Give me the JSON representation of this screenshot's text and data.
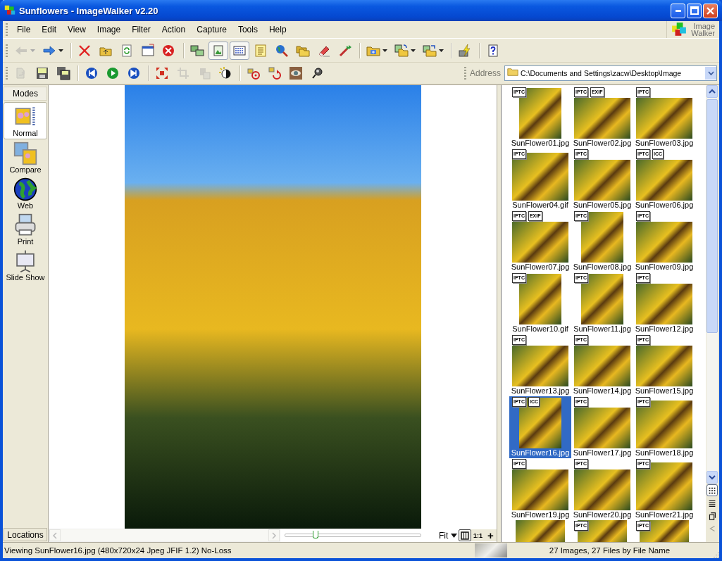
{
  "window": {
    "title": "Sunflowers - ImageWalker v2.20"
  },
  "menu": [
    "File",
    "Edit",
    "View",
    "Image",
    "Filter",
    "Action",
    "Capture",
    "Tools",
    "Help"
  ],
  "logo": {
    "text": "Image Walker"
  },
  "toolbar_main": [
    {
      "kind": "button",
      "disabled": true,
      "pressed": false,
      "dropdown": true
    },
    {
      "kind": "button",
      "disabled": false,
      "pressed": false,
      "dropdown": true
    },
    {
      "kind": "separator"
    },
    {
      "kind": "button",
      "disabled": false,
      "pressed": false,
      "dropdown": false
    },
    {
      "kind": "button",
      "disabled": false,
      "pressed": false,
      "dropdown": false
    },
    {
      "kind": "button",
      "disabled": false,
      "pressed": false,
      "dropdown": false
    },
    {
      "kind": "button",
      "disabled": false,
      "pressed": false,
      "dropdown": false
    },
    {
      "kind": "button",
      "disabled": false,
      "pressed": false,
      "dropdown": false
    },
    {
      "kind": "separator"
    },
    {
      "kind": "button",
      "disabled": false,
      "pressed": false,
      "dropdown": false
    },
    {
      "kind": "button",
      "disabled": false,
      "pressed": true,
      "dropdown": false
    },
    {
      "kind": "button",
      "disabled": false,
      "pressed": true,
      "dropdown": false
    },
    {
      "kind": "button",
      "disabled": false,
      "pressed": false,
      "dropdown": false
    },
    {
      "kind": "button",
      "disabled": false,
      "pressed": false,
      "dropdown": false
    },
    {
      "kind": "button",
      "disabled": false,
      "pressed": false,
      "dropdown": false
    },
    {
      "kind": "button",
      "disabled": false,
      "pressed": false,
      "dropdown": false
    },
    {
      "kind": "button",
      "disabled": false,
      "pressed": false,
      "dropdown": false
    },
    {
      "kind": "separator"
    },
    {
      "kind": "button",
      "disabled": false,
      "pressed": false,
      "dropdown": true
    },
    {
      "kind": "button",
      "disabled": false,
      "pressed": false,
      "dropdown": true
    },
    {
      "kind": "button",
      "disabled": false,
      "pressed": false,
      "dropdown": true
    },
    {
      "kind": "separator"
    },
    {
      "kind": "button",
      "disabled": false,
      "pressed": false,
      "dropdown": false
    },
    {
      "kind": "separator"
    },
    {
      "kind": "button",
      "disabled": false,
      "pressed": false,
      "dropdown": false
    }
  ],
  "toolbar_edit": [
    {
      "kind": "button",
      "disabled": true,
      "pressed": false,
      "dropdown": false
    },
    {
      "kind": "button",
      "disabled": false,
      "pressed": false,
      "dropdown": false
    },
    {
      "kind": "button",
      "disabled": false,
      "pressed": false,
      "dropdown": false
    },
    {
      "kind": "separator"
    },
    {
      "kind": "button",
      "disabled": false,
      "pressed": false,
      "dropdown": false
    },
    {
      "kind": "button",
      "disabled": false,
      "pressed": false,
      "dropdown": false
    },
    {
      "kind": "button",
      "disabled": false,
      "pressed": false,
      "dropdown": false
    },
    {
      "kind": "separator"
    },
    {
      "kind": "button",
      "disabled": false,
      "pressed": false,
      "dropdown": false
    },
    {
      "kind": "button",
      "disabled": true,
      "pressed": false,
      "dropdown": false
    },
    {
      "kind": "button",
      "disabled": true,
      "pressed": false,
      "dropdown": false
    },
    {
      "kind": "button",
      "disabled": false,
      "pressed": false,
      "dropdown": false
    },
    {
      "kind": "separator"
    },
    {
      "kind": "button",
      "disabled": false,
      "pressed": false,
      "dropdown": false
    },
    {
      "kind": "button",
      "disabled": false,
      "pressed": false,
      "dropdown": false
    },
    {
      "kind": "button",
      "disabled": false,
      "pressed": false,
      "dropdown": false
    },
    {
      "kind": "button",
      "disabled": false,
      "pressed": false,
      "dropdown": false
    }
  ],
  "address": {
    "label": "Address",
    "value": "C:\\Documents and Settings\\zacw\\Desktop\\Image"
  },
  "modes": {
    "title": "Modes",
    "items": [
      {
        "label": "Normal",
        "selected": true
      },
      {
        "label": "Compare",
        "selected": false
      },
      {
        "label": "Web",
        "selected": false
      },
      {
        "label": "Print",
        "selected": false
      },
      {
        "label": "Slide Show",
        "selected": false
      }
    ],
    "footer": "Locations"
  },
  "viewer": {
    "zoom": {
      "level": 0.22,
      "mode": "Fit"
    },
    "fit_button": {
      "pressed": true
    },
    "actual_size": "1:1",
    "zoom_in": "+"
  },
  "thumbnails": [
    {
      "name": "SunFlower01.jpg",
      "badges": [
        "IPTC"
      ],
      "kind": "portrait",
      "selected": false
    },
    {
      "name": "SunFlower02.jpg",
      "badges": [
        "IPTC",
        "EXIF"
      ],
      "kind": "landscape",
      "selected": false
    },
    {
      "name": "SunFlower03.jpg",
      "badges": [
        "IPTC"
      ],
      "kind": "landscape",
      "selected": false
    },
    {
      "name": "SunFlower04.gif",
      "badges": [
        "IPTC"
      ],
      "kind": "square",
      "selected": false
    },
    {
      "name": "SunFlower05.jpg",
      "badges": [
        "IPTC"
      ],
      "kind": "landscape",
      "selected": false
    },
    {
      "name": "SunFlower06.jpg",
      "badges": [
        "IPTC",
        "ICC"
      ],
      "kind": "landscape",
      "selected": false
    },
    {
      "name": "SunFlower07.jpg",
      "badges": [
        "IPTC",
        "EXIF"
      ],
      "kind": "landscape",
      "selected": false
    },
    {
      "name": "SunFlower08.jpg",
      "badges": [
        "IPTC"
      ],
      "kind": "portrait",
      "selected": false
    },
    {
      "name": "SunFlower09.jpg",
      "badges": [
        "IPTC"
      ],
      "kind": "landscape",
      "selected": false
    },
    {
      "name": "SunFlower10.gif",
      "badges": [
        "IPTC"
      ],
      "kind": "portrait",
      "selected": false
    },
    {
      "name": "SunFlower11.jpg",
      "badges": [
        "IPTC"
      ],
      "kind": "portrait",
      "selected": false
    },
    {
      "name": "SunFlower12.jpg",
      "badges": [
        "IPTC"
      ],
      "kind": "landscape",
      "selected": false
    },
    {
      "name": "SunFlower13.jpg",
      "badges": [
        "IPTC"
      ],
      "kind": "landscape",
      "selected": false
    },
    {
      "name": "SunFlower14.jpg",
      "badges": [
        "IPTC"
      ],
      "kind": "landscape",
      "selected": false
    },
    {
      "name": "SunFlower15.jpg",
      "badges": [
        "IPTC"
      ],
      "kind": "landscape",
      "selected": false
    },
    {
      "name": "SunFlower16.jpg",
      "badges": [
        "IPTC",
        "ICC"
      ],
      "kind": "portrait",
      "selected": true
    },
    {
      "name": "SunFlower17.jpg",
      "badges": [
        "IPTC"
      ],
      "kind": "landscape",
      "selected": false
    },
    {
      "name": "SunFlower18.jpg",
      "badges": [
        "IPTC"
      ],
      "kind": "square",
      "selected": false
    },
    {
      "name": "SunFlower19.jpg",
      "badges": [
        "IPTC"
      ],
      "kind": "landscape",
      "selected": false
    },
    {
      "name": "SunFlower20.jpg",
      "badges": [
        "IPTC"
      ],
      "kind": "landscape",
      "selected": false
    },
    {
      "name": "SunFlower21.jpg",
      "badges": [
        "IPTC"
      ],
      "kind": "square",
      "selected": false
    },
    {
      "kind": "partial",
      "selected": false
    },
    {
      "badges": [
        "IPTC"
      ],
      "kind": "partial",
      "selected": false
    },
    {
      "badges": [
        "IPTC"
      ],
      "kind": "partial",
      "selected": false
    }
  ],
  "thumb_views": [
    {
      "selected": true,
      "disabled": false
    },
    {
      "selected": false,
      "disabled": false
    },
    {
      "selected": false,
      "disabled": false
    },
    {
      "selected": false,
      "disabled": true
    }
  ],
  "status_bar": {
    "left": "Viewing SunFlower16.jpg (480x720x24 Jpeg JFIF 1.2) No-Loss",
    "right": "27 Images, 27 Files by File Name"
  }
}
